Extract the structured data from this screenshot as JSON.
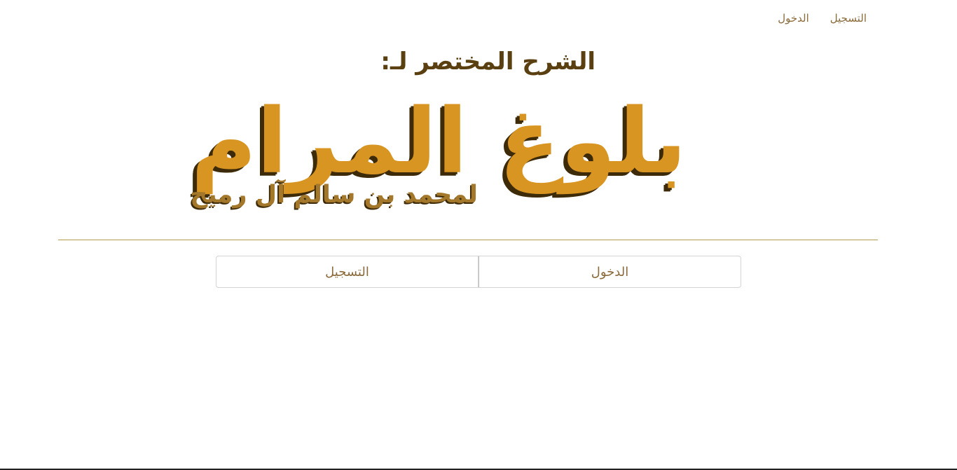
{
  "nav": {
    "login_label": "الدخول",
    "register_label": "التسجيل"
  },
  "logo": {
    "subtitle": "الشرح المختصر لـ:",
    "title": "بلوغ المرام",
    "author": "لمحمد بن سالم آل رميح"
  },
  "actions": {
    "login_label": "الدخول",
    "register_label": "التسجيل"
  },
  "colors": {
    "accent": "#d99522",
    "link": "#8a6a3a",
    "dark": "#5a3f10",
    "divider": "#b59a50"
  }
}
